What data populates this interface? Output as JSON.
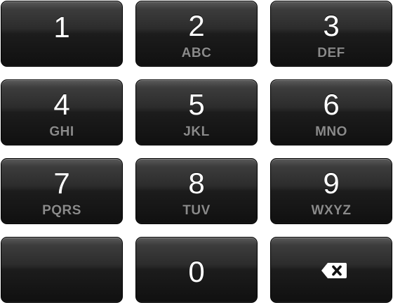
{
  "keypad": {
    "keys": [
      {
        "digit": "1",
        "letters": ""
      },
      {
        "digit": "2",
        "letters": "ABC"
      },
      {
        "digit": "3",
        "letters": "DEF"
      },
      {
        "digit": "4",
        "letters": "GHI"
      },
      {
        "digit": "5",
        "letters": "JKL"
      },
      {
        "digit": "6",
        "letters": "MNO"
      },
      {
        "digit": "7",
        "letters": "PQRS"
      },
      {
        "digit": "8",
        "letters": "TUV"
      },
      {
        "digit": "9",
        "letters": "WXYZ"
      },
      {
        "digit": "0",
        "letters": ""
      }
    ],
    "delete_icon": "backspace-icon",
    "colors": {
      "key_top": "#3c3c3c",
      "key_bottom": "#101010",
      "digit": "#ffffff",
      "letters": "#8a8a8a"
    }
  }
}
